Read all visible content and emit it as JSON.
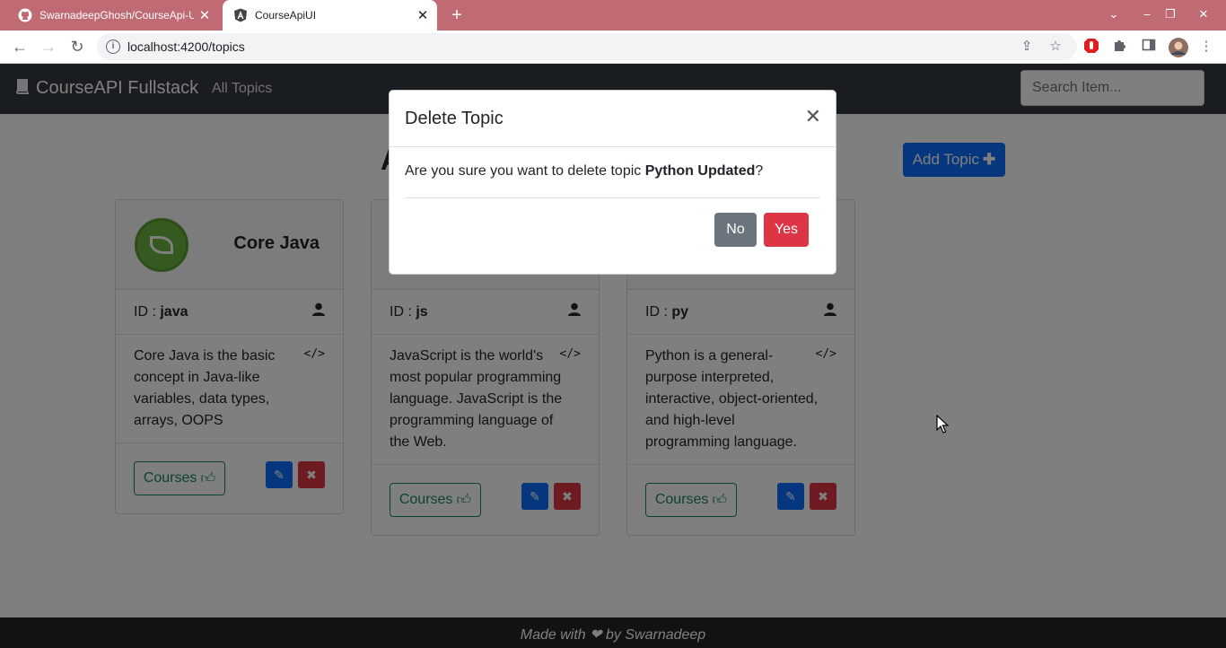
{
  "browser": {
    "tabs": [
      {
        "title": "SwarnadeepGhosh/CourseApi-UI",
        "icon": "github-icon"
      },
      {
        "title": "CourseApiUI",
        "icon": "angular-icon"
      }
    ],
    "url": "localhost:4200/topics"
  },
  "navbar": {
    "brand": "CourseAPI Fullstack",
    "link": "All Topics",
    "search_placeholder": "Search Item..."
  },
  "page": {
    "heading_visible": "A",
    "add_button": "Add Topic"
  },
  "cards": [
    {
      "title": "Core Java",
      "id_label": "ID : ",
      "id": "java",
      "description": "Core Java is the basic concept in Java-like variables, data types, arrays, OOPS",
      "courses_label": "Courses"
    },
    {
      "title": "",
      "id_label": "ID : ",
      "id": "js",
      "description": "JavaScript is the world's most popular programming language. JavaScript is the programming language of the Web.",
      "courses_label": "Courses"
    },
    {
      "title": "",
      "id_label": "ID : ",
      "id": "py",
      "description": "Python is a general-purpose interpreted, interactive, object-oriented, and high-level programming language.",
      "courses_label": "Courses"
    }
  ],
  "footer": {
    "before": "Made with",
    "after": "by Swarnadeep"
  },
  "modal": {
    "title": "Delete Topic",
    "message_prefix": "Are you sure you want to delete topic ",
    "topic_name": "Python Updated",
    "message_suffix": "?",
    "no_label": "No",
    "yes_label": "Yes"
  },
  "colors": {
    "tabstrip": "#c06a73",
    "navbar": "#343a40",
    "primary": "#0d6efd",
    "danger": "#dc3545",
    "success": "#198754",
    "secondary": "#6c757d"
  }
}
